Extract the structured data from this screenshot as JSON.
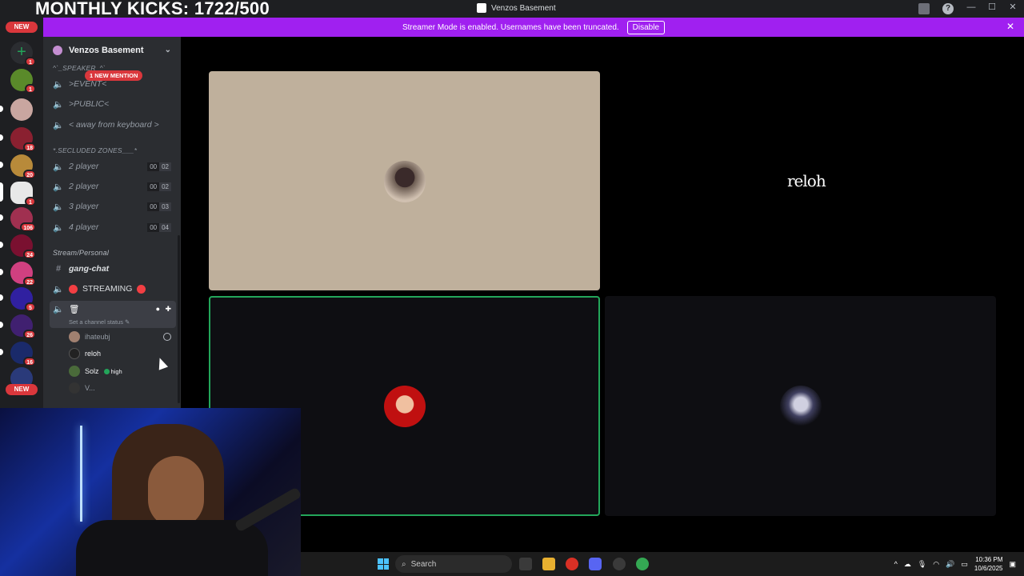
{
  "overlay": {
    "title": "MONTHLY KICKS: 1722/500"
  },
  "window": {
    "title": "Venzos Basement"
  },
  "banner": {
    "text": "Streamer Mode is enabled. Usernames have been truncated.",
    "button": "Disable"
  },
  "rail": {
    "new_top": "NEW",
    "new_bottom": "NEW",
    "servers": [
      {
        "badge": "1"
      },
      {
        "badge": "1"
      },
      {
        "badge": ""
      },
      {
        "badge": "18"
      },
      {
        "badge": "20"
      },
      {
        "badge": "1"
      },
      {
        "badge": "106"
      },
      {
        "badge": "24"
      },
      {
        "badge": "22"
      },
      {
        "badge": "5"
      },
      {
        "badge": "26"
      },
      {
        "badge": "16"
      }
    ]
  },
  "sidebar": {
    "guild_name": "Venzos Basement",
    "mention": "1 NEW MENTION",
    "cat_speaker": "^`_SPEAKER_^`",
    "channels_top": [
      ">EVENT<",
      ">PUBLIC<",
      "< away from keyboard >"
    ],
    "cat_secluded": "*.SECLUDED ZONES___*",
    "secluded": [
      {
        "name": "2 player",
        "a": "00",
        "b": "02"
      },
      {
        "name": "2 player",
        "a": "00",
        "b": "02"
      },
      {
        "name": "3 player",
        "a": "00",
        "b": "03"
      },
      {
        "name": "4 player",
        "a": "00",
        "b": "04"
      }
    ],
    "cat_stream": "Stream/Personal",
    "gang_chat": "gang-chat",
    "streaming": "STREAMING",
    "status_prompt": "Set a channel status",
    "members": [
      {
        "name": "ihateubj"
      },
      {
        "name": "reloh"
      },
      {
        "name": "Solz",
        "badge": "high"
      },
      {
        "name": "V..."
      }
    ]
  },
  "tiles": {
    "reloh_name": "reloh"
  },
  "taskbar": {
    "search_placeholder": "Search",
    "time": "10:36 PM",
    "date": "10/6/2025"
  },
  "colors": {
    "brand": "#5865f2",
    "banner": "#a020f0",
    "speaking": "#23a55a"
  }
}
